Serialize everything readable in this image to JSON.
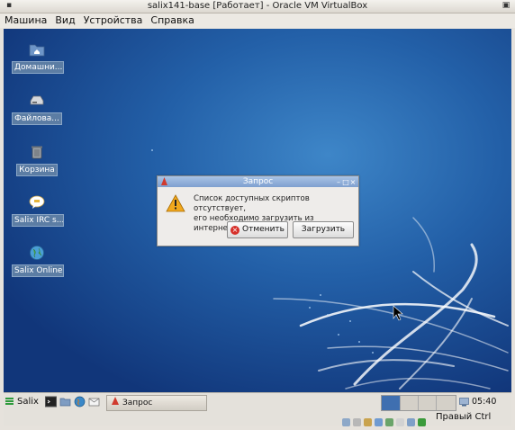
{
  "window": {
    "title": "salix141-base [Работает] - Oracle VM VirtualBox"
  },
  "menu": [
    "Машина",
    "Вид",
    "Устройства",
    "Справка"
  ],
  "desktop_icons": [
    {
      "label": "Домашни...",
      "icon": "home-folder-icon"
    },
    {
      "label": "Файлова...",
      "icon": "drive-icon"
    },
    {
      "label": "Корзина",
      "icon": "trash-icon"
    },
    {
      "label": "Salix IRC s...",
      "icon": "chat-bubble-icon"
    },
    {
      "label": "Salix Online",
      "icon": "globe-icon"
    }
  ],
  "dialog": {
    "title": "Запрос",
    "message_line1": "Список доступных скриптов отсутствует,",
    "message_line2": "его необходимо загрузить из интернета.",
    "cancel_label": "Отменить",
    "download_label": "Загрузить"
  },
  "taskbar": {
    "start_label": "Salix",
    "task_label": "Запрос",
    "clock": "05:40",
    "host_key": "Правый Ctrl"
  },
  "colors": {
    "accent": "#2360a8",
    "warning": "#f2a81d",
    "cancel": "#d6302a"
  }
}
